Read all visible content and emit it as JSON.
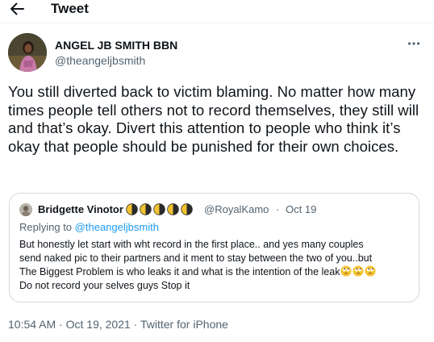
{
  "header": {
    "back_icon": "arrow-left-icon",
    "title": "Tweet"
  },
  "author": {
    "name": "ANGEL JB SMITH BBN",
    "handle": "@theangeljbsmith"
  },
  "more_icon": "more-horizontal-icon",
  "tweet": {
    "text": "You still diverted back to victim blaming. No matter how many times people tell others not to record themselves, they still will and that’s okay. Divert this attention to people who think it’s okay that people should be punished for their own choices."
  },
  "quote": {
    "name": "Bridgette Vinotor",
    "name_emojis": [
      "yin-yang-icon",
      "yin-yang-icon",
      "yin-yang-icon",
      "yin-yang-icon",
      "yin-yang-icon"
    ],
    "handle": "@RoyalKamo",
    "separator": "·",
    "date": "Oct 19",
    "reply_prefix": "Replying to",
    "reply_handle": "@theangeljbsmith",
    "lines": [
      "But honestly let start with wht record in the first place.. and yes many couples",
      "send naked pic to their partners and it ment to stay between the two of you..but",
      "The Biggest Problem is who leaks it and what is the intention of the leak",
      "Do not record your selves guys Stop it"
    ],
    "line3_emojis": [
      "face-with-rolling-eyes-icon",
      "face-with-rolling-eyes-icon",
      "face-with-rolling-eyes-icon"
    ]
  },
  "meta": {
    "time": "10:54 AM",
    "separator": "·",
    "date": "Oct 19, 2021",
    "source": "Twitter for iPhone"
  },
  "colors": {
    "text_primary": "#0f1419",
    "text_secondary": "#536471",
    "link": "#1d9bf0",
    "border": "#cfd9de"
  }
}
